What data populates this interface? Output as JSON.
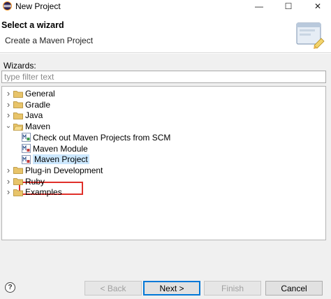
{
  "window": {
    "title": "New Project",
    "minimize_glyph": "—",
    "maximize_glyph": "☐",
    "close_glyph": "✕"
  },
  "header": {
    "title": "Select a wizard",
    "description": "Create a Maven Project"
  },
  "wizards": {
    "label": "Wizards:",
    "filter_placeholder": "type filter text"
  },
  "tree": [
    {
      "label": "General",
      "type": "folder",
      "expanded": false,
      "level": 0
    },
    {
      "label": "Gradle",
      "type": "folder",
      "expanded": false,
      "level": 0
    },
    {
      "label": "Java",
      "type": "folder",
      "expanded": false,
      "level": 0
    },
    {
      "label": "Maven",
      "type": "folder",
      "expanded": true,
      "level": 0
    },
    {
      "label": "Check out Maven Projects from SCM",
      "type": "maven-scm",
      "level": 1
    },
    {
      "label": "Maven Module",
      "type": "maven",
      "level": 1
    },
    {
      "label": "Maven Project",
      "type": "maven",
      "level": 1,
      "selected": true
    },
    {
      "label": "Plug-in Development",
      "type": "folder",
      "expanded": false,
      "level": 0
    },
    {
      "label": "Ruby",
      "type": "folder",
      "expanded": false,
      "level": 0
    },
    {
      "label": "Examples",
      "type": "folder",
      "expanded": false,
      "level": 0
    }
  ],
  "footer": {
    "help": "?",
    "back": "< Back",
    "next": "Next >",
    "finish": "Finish",
    "cancel": "Cancel"
  },
  "colors": {
    "highlight_box": "#e0302a",
    "folder_fill": "#e8c46a",
    "folder_stroke": "#b08a2e",
    "default_button_border": "#0078d7"
  },
  "icons": {
    "app": "eclipse-icon",
    "folder": "folder-icon",
    "maven": "maven-icon",
    "collapsed": "chevron-right-icon",
    "expanded": "chevron-down-icon"
  }
}
